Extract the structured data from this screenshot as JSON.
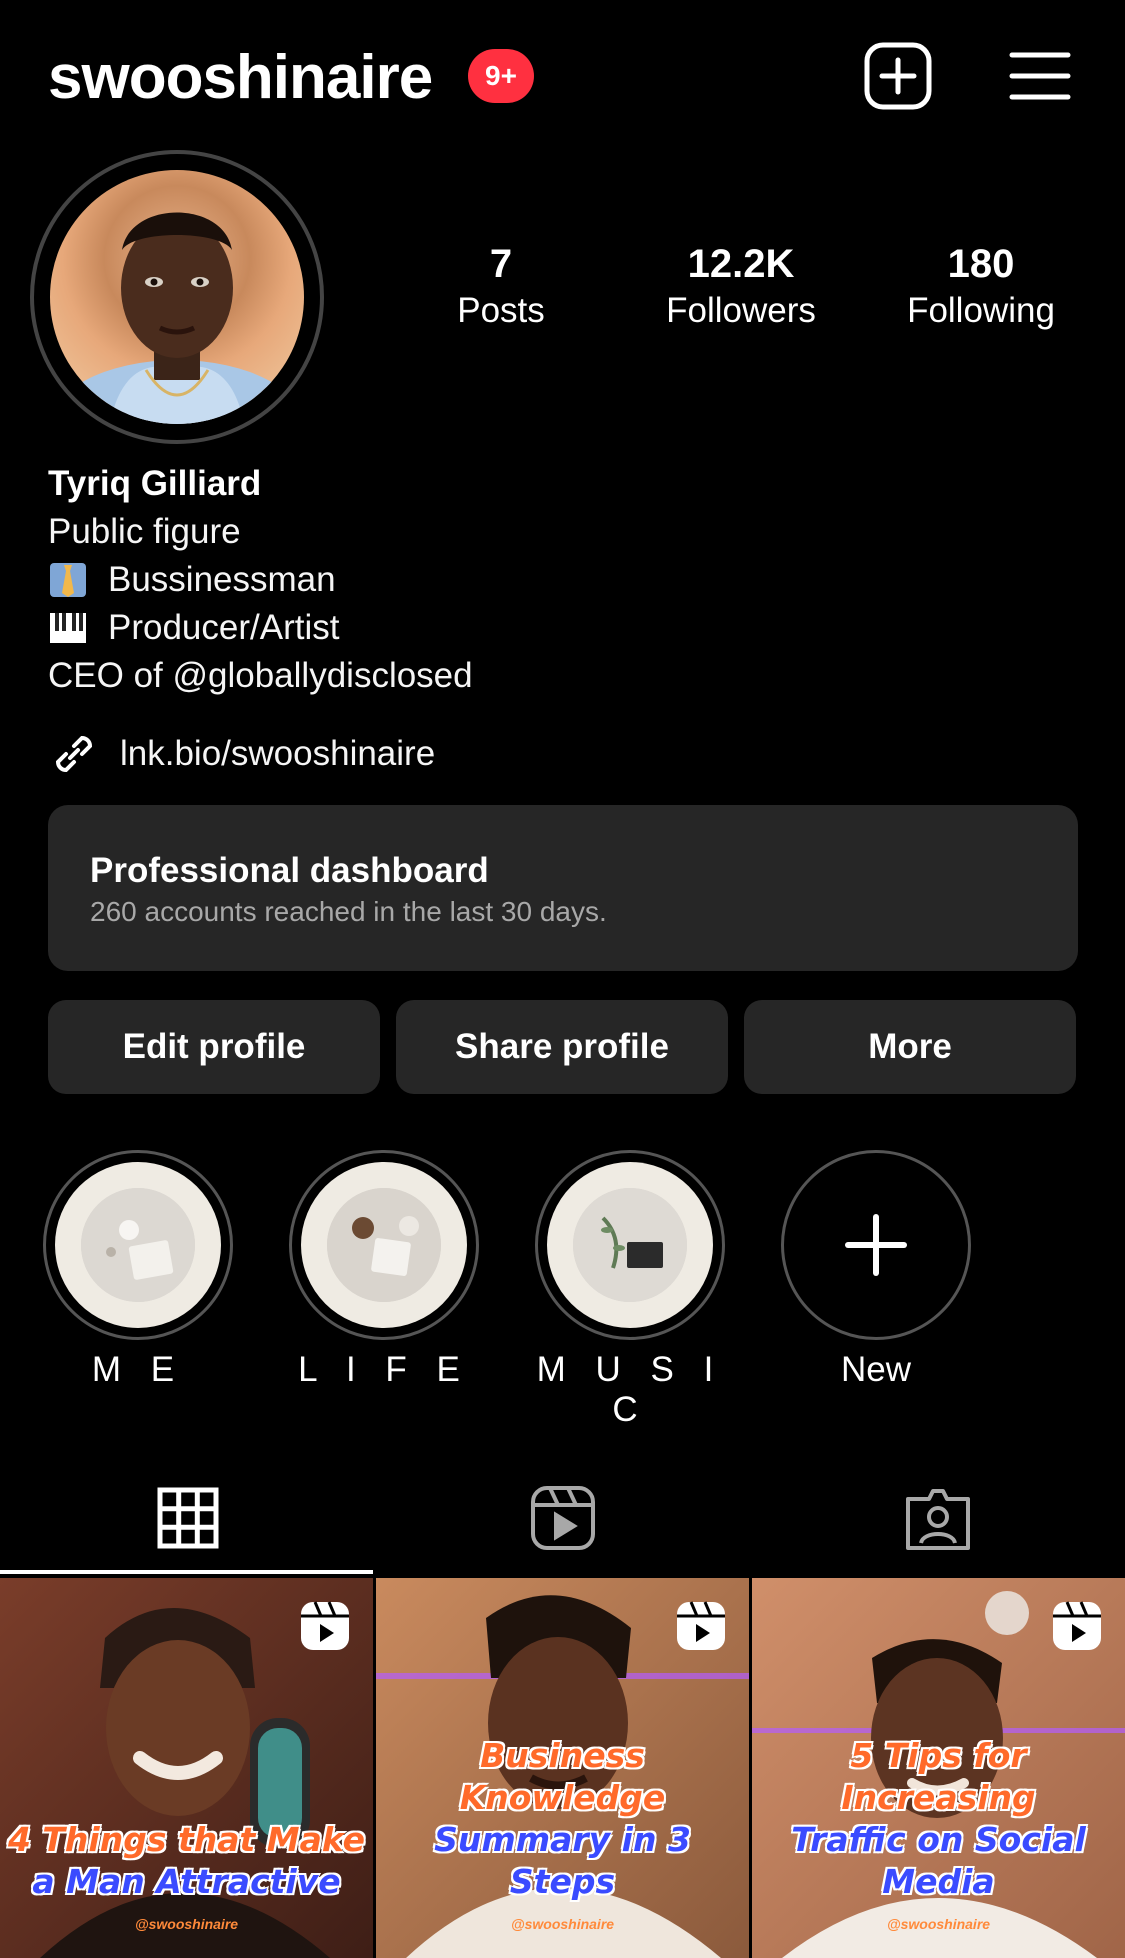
{
  "header": {
    "username": "swooshinaire",
    "notification_badge": "9+",
    "new_post_icon": "plus-square-icon",
    "menu_icon": "hamburger-menu-icon"
  },
  "stats": [
    {
      "value": "7",
      "label": "Posts"
    },
    {
      "value": "12.2K",
      "label": "Followers"
    },
    {
      "value": "180",
      "label": "Following"
    }
  ],
  "bio": {
    "name": "Tyriq Gilliard",
    "category": "Public figure",
    "lines": [
      "Bussinessman",
      "Producer/Artist",
      "CEO of @globallydisclosed"
    ],
    "line_icons": [
      "necktie-emoji",
      "piano-keys-emoji"
    ],
    "link": "lnk.bio/swooshinaire"
  },
  "dashboard": {
    "title": "Professional dashboard",
    "subtitle": "260 accounts reached in the last 30 days."
  },
  "buttons": {
    "edit": "Edit profile",
    "share": "Share profile",
    "more": "More"
  },
  "highlights": [
    {
      "label": "M E"
    },
    {
      "label": "L I F E"
    },
    {
      "label": "M U S I C"
    },
    {
      "label": "New"
    }
  ],
  "tabs": {
    "grid_icon": "grid-icon",
    "reels_icon": "reels-icon",
    "tagged_icon": "tagged-person-icon",
    "active": "grid"
  },
  "posts": [
    {
      "line1": "4 Things that Make",
      "line2": "a Man Attractive",
      "handle": "@swooshinaire"
    },
    {
      "line1": "Business Knowledge",
      "line2": "Summary in 3 Steps",
      "handle": "@swooshinaire"
    },
    {
      "line1": "5 Tips for Increasing",
      "line2": "Traffic on Social Media",
      "handle": "@swooshinaire"
    }
  ],
  "colors": {
    "background": "#000000",
    "card": "#262626",
    "badge": "#ff3040",
    "secondary_text": "#a8a8a8"
  }
}
